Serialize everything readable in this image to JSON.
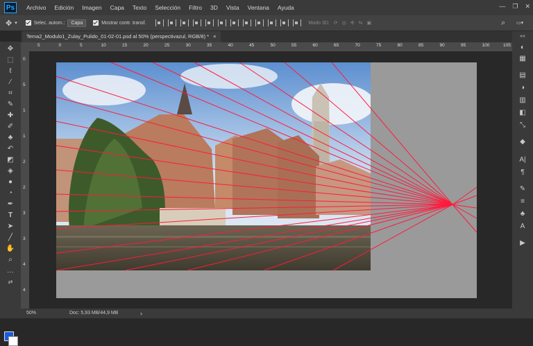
{
  "app": {
    "logo": "Ps"
  },
  "menu": [
    "Archivo",
    "Edición",
    "Imagen",
    "Capa",
    "Texto",
    "Selección",
    "Filtro",
    "3D",
    "Vista",
    "Ventana",
    "Ayuda"
  ],
  "options": {
    "auto_select_label": "Selec. autom.:",
    "auto_select_value": "Capa",
    "transform_label": "Mostrar contr. transf.",
    "mode3d_label": "Modo 3D:"
  },
  "tab": {
    "title": "Tema2_Modulo1_Zulay_Pulido_01-02-01.psd al 50% (perspectivazul, RGB/8) *",
    "close": "×"
  },
  "ruler": {
    "h_labels": [
      "5",
      "0",
      "5",
      "10",
      "15",
      "20",
      "25",
      "30",
      "35",
      "40",
      "45",
      "50",
      "55",
      "60",
      "65",
      "70",
      "75",
      "80",
      "85",
      "90",
      "95",
      "100",
      "105"
    ],
    "v_labels": [
      "0",
      "5",
      "1",
      "1",
      "2",
      "2",
      "3",
      "3",
      "4",
      "4"
    ]
  },
  "status": {
    "zoom": "50%",
    "doc": "Doc: 5,93 MB/44,9 MB",
    "arrow": "›"
  },
  "colors": {
    "perspective_line": "#ff1a3c",
    "foreground": "#1a5cd6",
    "background": "#ffffff"
  }
}
